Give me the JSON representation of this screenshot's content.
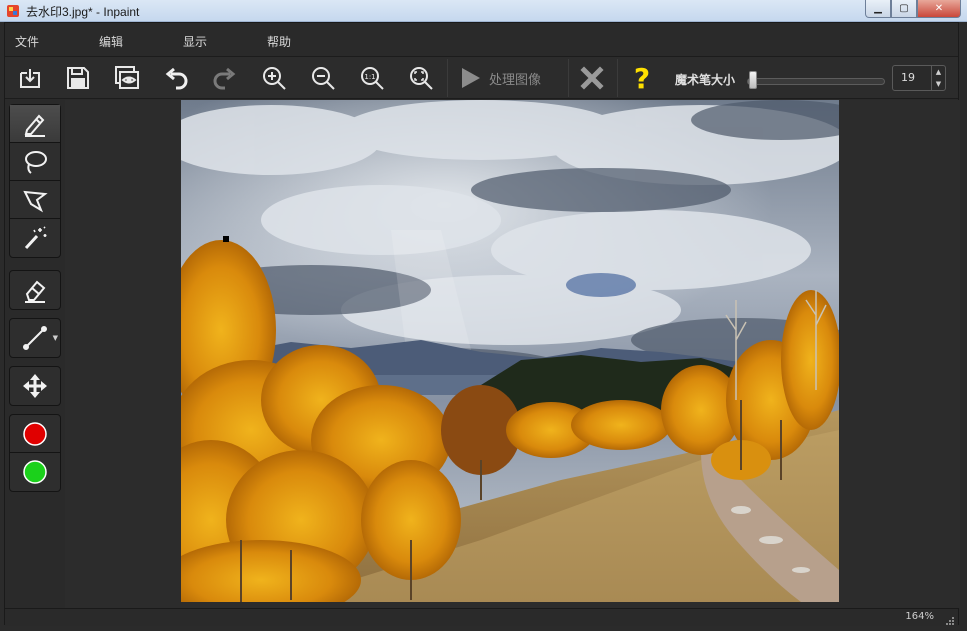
{
  "window": {
    "title": "去水印3.jpg* - Inpaint",
    "controls": {
      "minimize": "▁",
      "maximize": "▢",
      "close": "✕"
    }
  },
  "menu": {
    "file": "文件",
    "edit": "编辑",
    "view": "显示",
    "help": "帮助"
  },
  "toolbar": {
    "process_label": "处理图像",
    "brush_size_label": "魔术笔大小",
    "brush_size_value": "19",
    "brush_size_max": 100,
    "help_glyph": "?"
  },
  "icons": {
    "toolbar": [
      "open-icon",
      "save-icon",
      "preview-icon",
      "undo-icon",
      "redo-icon",
      "zoom-in-icon",
      "zoom-out-icon",
      "zoom-actual-icon",
      "zoom-fit-icon",
      "play-icon",
      "cancel-icon",
      "help-icon"
    ],
    "tools": [
      "marker-icon",
      "lasso-icon",
      "polygon-lasso-icon",
      "magic-wand-icon",
      "eraser-icon",
      "line-icon",
      "move-icon",
      "red-dot-icon",
      "green-dot-icon"
    ]
  },
  "colors": {
    "red_marker": "#e00000",
    "green_marker": "#1bd11b",
    "help_yellow": "#ffe000"
  },
  "status": {
    "zoom": "164%"
  }
}
